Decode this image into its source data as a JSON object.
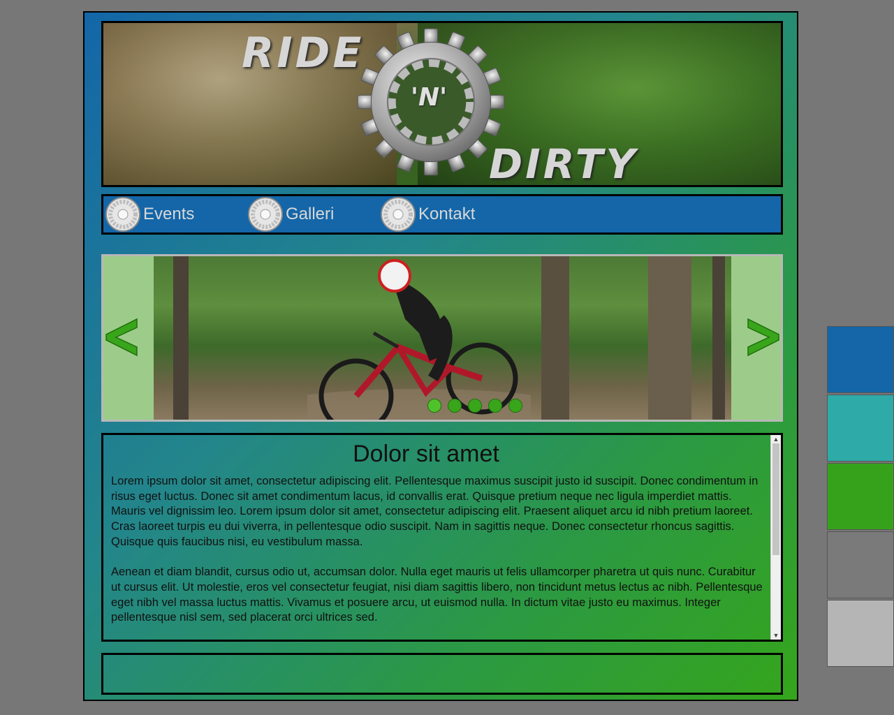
{
  "header": {
    "logo_top": "RIDE",
    "logo_middle": "'N'",
    "logo_bottom": "DIRTY"
  },
  "nav": {
    "items": [
      {
        "label": "Events",
        "icon": "cog-icon"
      },
      {
        "label": "Galleri",
        "icon": "cog-icon"
      },
      {
        "label": "Kontakt",
        "icon": "cog-icon"
      }
    ]
  },
  "slider": {
    "prev_glyph": "<",
    "next_glyph": ">",
    "dot_count": 5,
    "active_dot": 0,
    "arrow_color": "#39a51a"
  },
  "content": {
    "title": "Dolor sit amet",
    "paragraphs": [
      "Lorem ipsum dolor sit amet, consectetur adipiscing elit. Pellentesque maximus suscipit justo id suscipit. Donec condimentum in risus eget luctus. Donec sit amet condimentum lacus, id convallis erat. Quisque pretium neque nec ligula imperdiet mattis. Mauris vel dignissim leo. Lorem ipsum dolor sit amet, consectetur adipiscing elit. Praesent aliquet arcu id nibh pretium laoreet. Cras laoreet turpis eu dui viverra, in pellentesque odio suscipit. Nam in sagittis neque. Donec consectetur rhoncus sagittis. Quisque quis faucibus nisi, eu vestibulum massa.",
      "Aenean et diam blandit, cursus odio ut, accumsan dolor. Nulla eget mauris ut felis ullamcorper pharetra ut quis nunc. Curabitur ut cursus elit. Ut molestie, eros vel consectetur feugiat, nisi diam sagittis libero, non tincidunt metus lectus ac nibh. Pellentesque eget nibh vel massa luctus mattis. Vivamus et posuere arcu, ut euismod nulla. In dictum vitae justo eu maximus. Integer pellentesque nisl sem, sed placerat orci ultrices sed."
    ]
  },
  "palette": {
    "colors": [
      "#1466a8",
      "#2eaaa8",
      "#36a21c",
      "#7a7a7a",
      "#b5b5b5"
    ]
  }
}
